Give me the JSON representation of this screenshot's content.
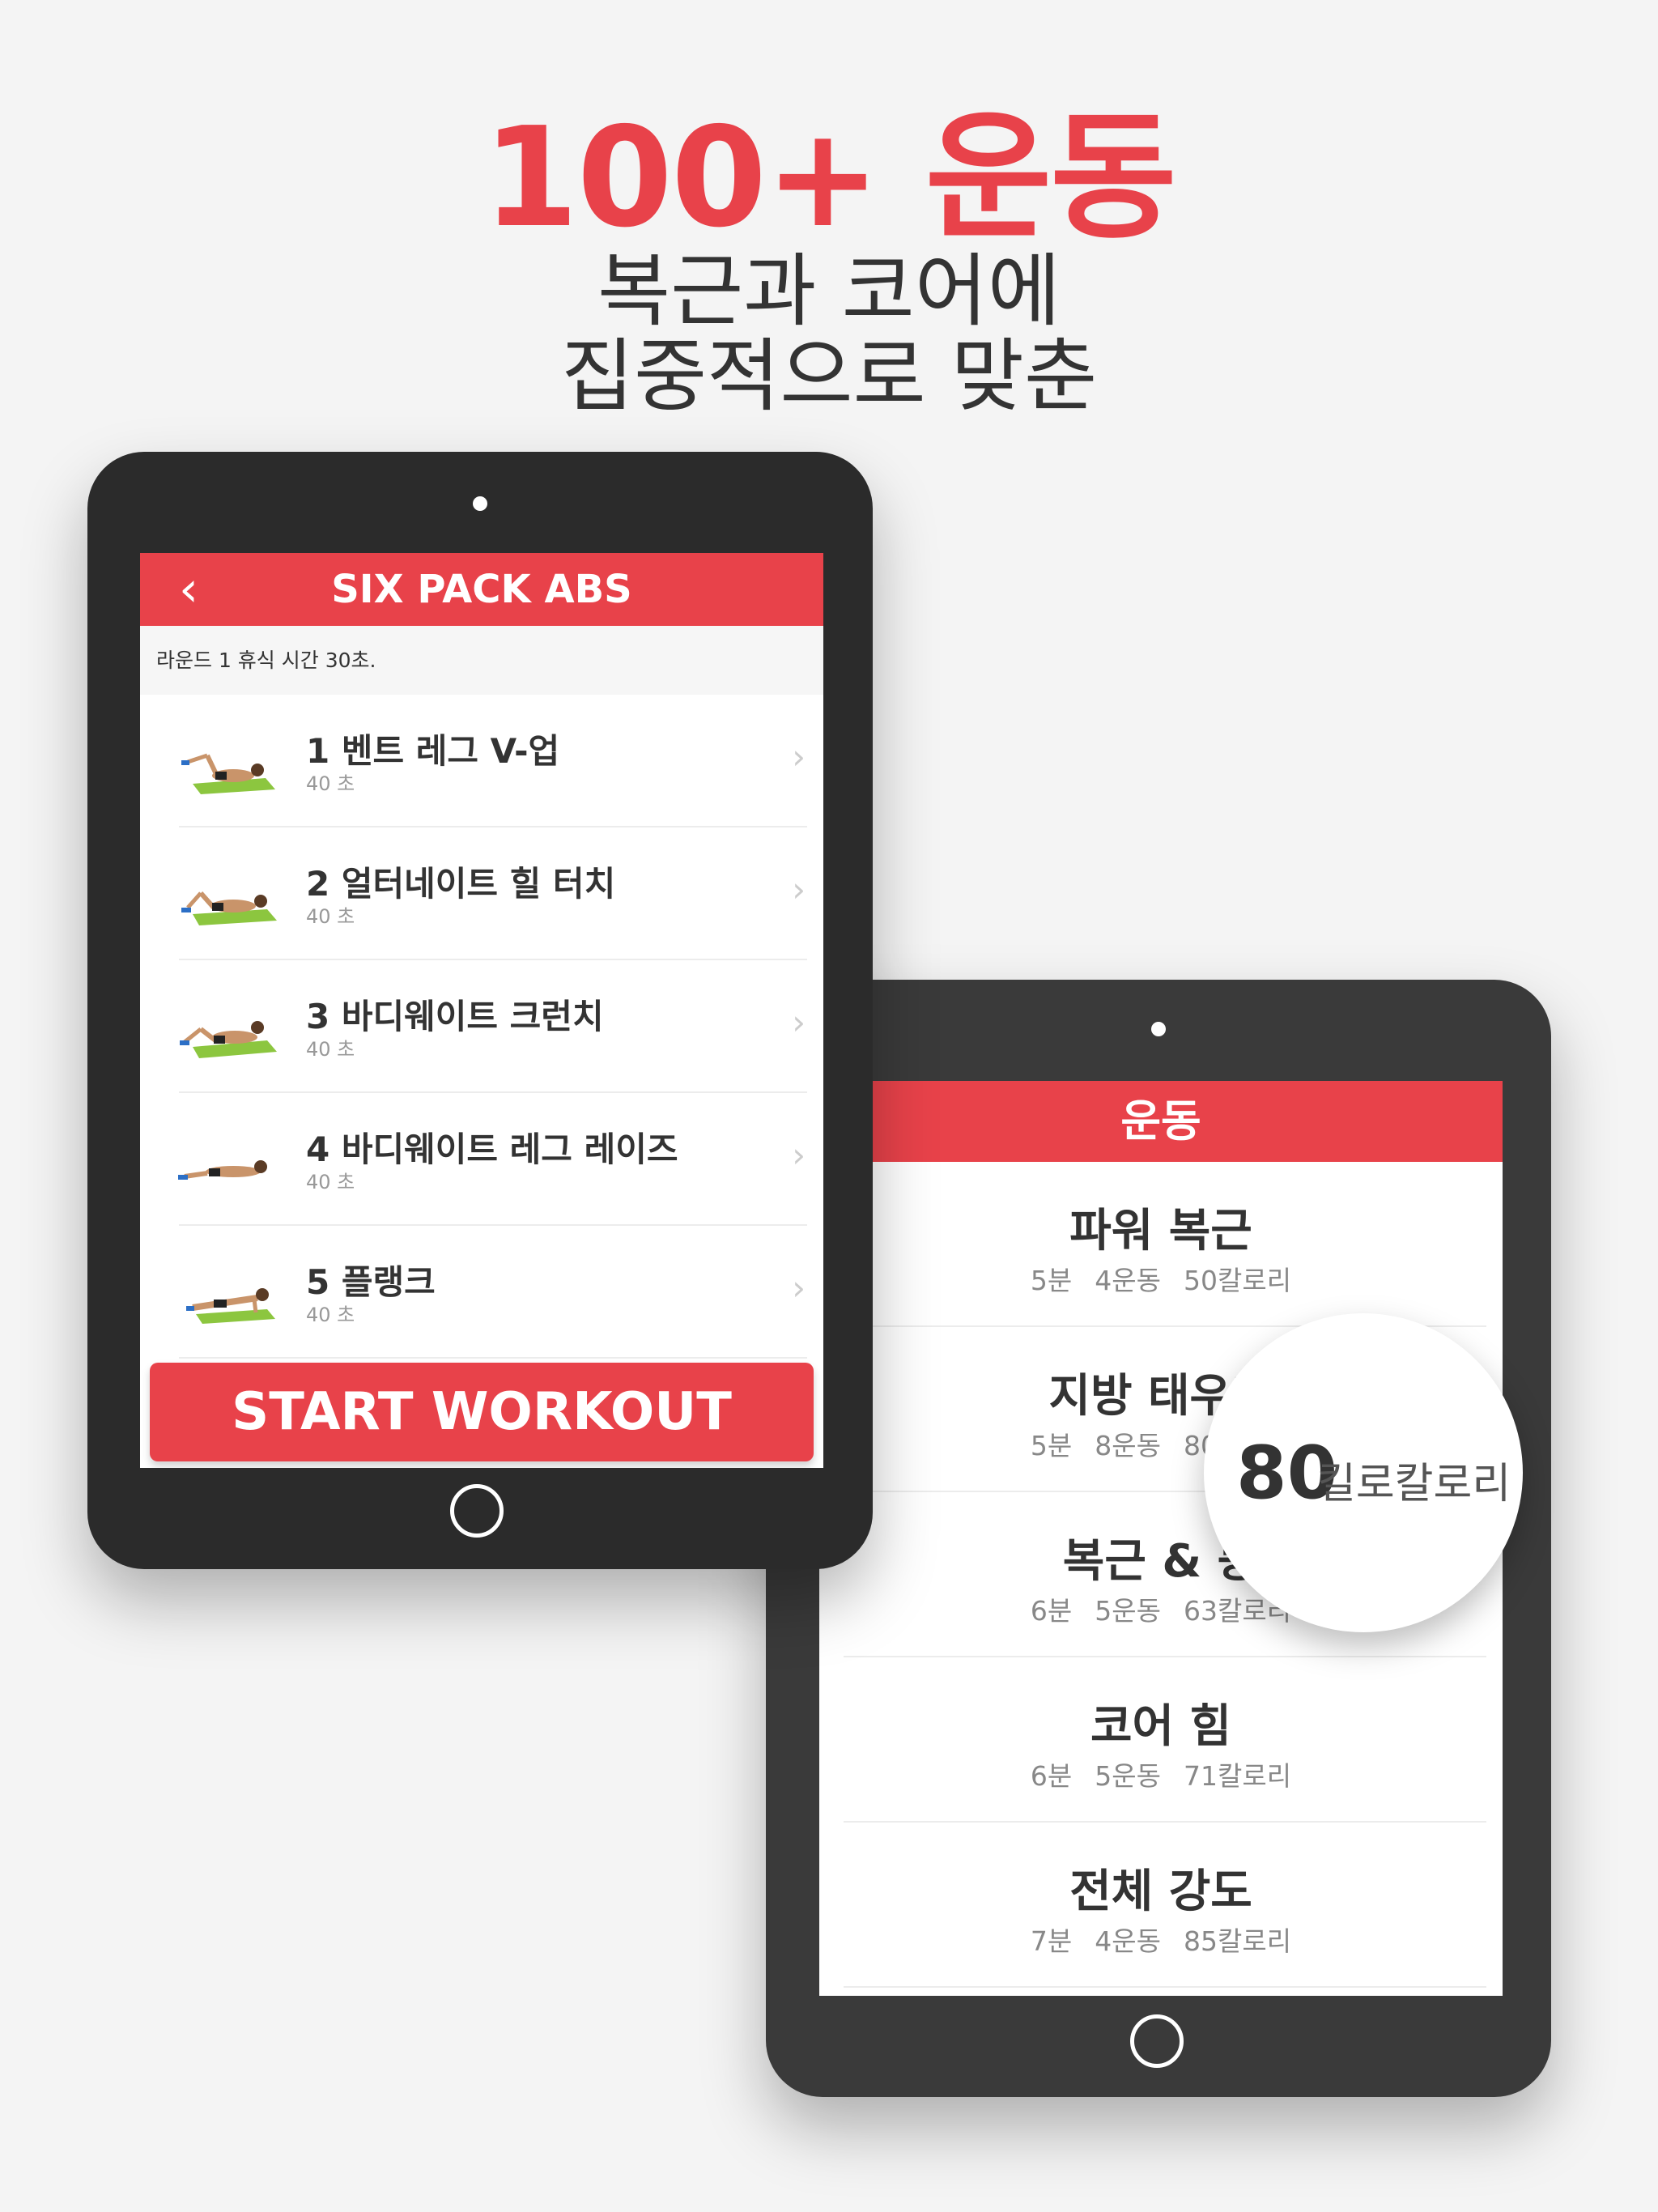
{
  "headline": {
    "line1": "100+ 운동",
    "line2": "복근과 코어에",
    "line3": "집중적으로 맞춘"
  },
  "workout_list_screen": {
    "title": "운동",
    "items": [
      {
        "name": "파워 복근",
        "minutes": "5분",
        "exercises": "4운동",
        "calories": "50칼로리"
      },
      {
        "name": "지방 태우기",
        "minutes": "5분",
        "exercises": "8운동",
        "calories": "80칼로리"
      },
      {
        "name": "복근 & 등",
        "minutes": "6분",
        "exercises": "5운동",
        "calories": "63칼로리"
      },
      {
        "name": "코어 힘",
        "minutes": "6분",
        "exercises": "5운동",
        "calories": "71칼로리"
      },
      {
        "name": "전체 강도",
        "minutes": "7분",
        "exercises": "4운동",
        "calories": "85칼로리"
      }
    ]
  },
  "magnifier": {
    "value": "80",
    "unit": "킬로칼로리"
  },
  "detail_screen": {
    "title": "SIX PACK ABS",
    "back_icon": "chevron-left-icon",
    "round_info": "라운드 1 휴식 시간 30초.",
    "exercises": [
      {
        "label": "1 벤트 레그 V-업",
        "duration": "40 초"
      },
      {
        "label": "2 얼터네이트 힐 터치",
        "duration": "40 초"
      },
      {
        "label": "3 바디웨이트 크런치",
        "duration": "40 초"
      },
      {
        "label": "4 바디웨이트 레그 레이즈",
        "duration": "40 초"
      },
      {
        "label": "5 플랭크",
        "duration": "40 초"
      }
    ],
    "start_button": "START WORKOUT"
  },
  "colors": {
    "accent": "#e8424a",
    "tablet_dark": "#2b2b2b",
    "tablet_gray": "#3a3a3a",
    "mat_green": "#8cc63f"
  }
}
